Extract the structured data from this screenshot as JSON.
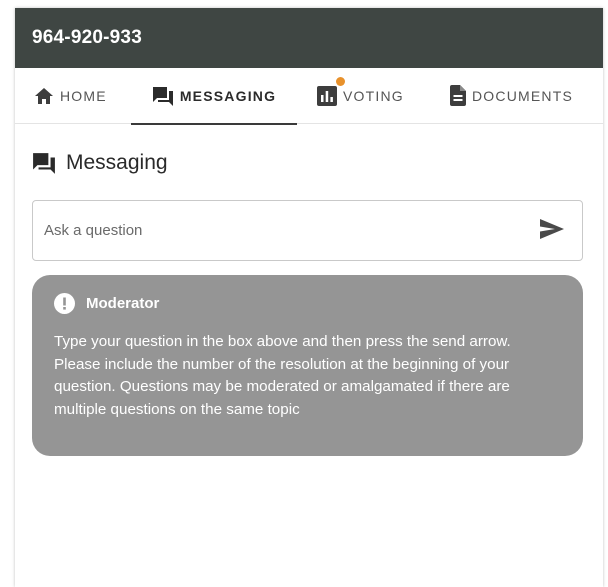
{
  "header": {
    "title": "964-920-933"
  },
  "tabs": [
    {
      "id": "home",
      "label": "HOME",
      "icon": "home-icon",
      "active": false
    },
    {
      "id": "messaging",
      "label": "MESSAGING",
      "icon": "chat-icon",
      "active": true
    },
    {
      "id": "voting",
      "label": "VOTING",
      "icon": "bar-chart-icon",
      "active": false,
      "notification": true
    },
    {
      "id": "documents",
      "label": "DOCUMENTS",
      "icon": "document-icon",
      "active": false
    }
  ],
  "messaging": {
    "title": "Messaging",
    "input": {
      "placeholder": "Ask a question",
      "value": ""
    },
    "send_icon": "send-icon"
  },
  "moderator": {
    "name": "Moderator",
    "icon": "alert-icon",
    "message": "Type your question in the box above and then press the send arrow. Please include the number of the resolution at the beginning of your question. Questions may be moderated or amalgamated if there are multiple questions on the same topic"
  },
  "colors": {
    "header_bg": "#3f4643",
    "notification_dot": "#e8912b",
    "moderator_bg": "#959595",
    "active_tab_underline": "#3a3a3a"
  }
}
